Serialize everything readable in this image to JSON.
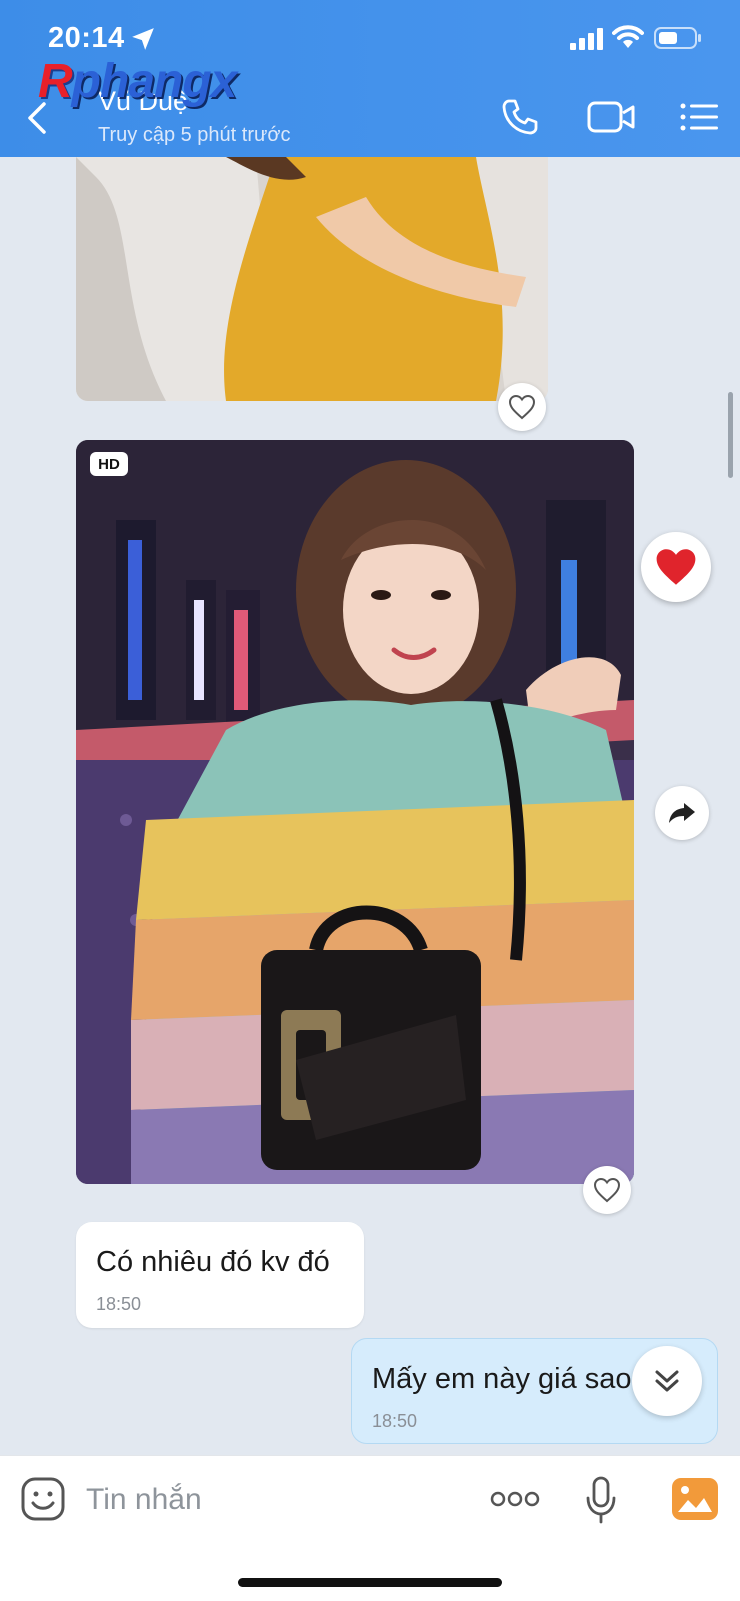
{
  "status_bar": {
    "time": "20:14"
  },
  "watermark": {
    "part1": "R",
    "part2": "phangx"
  },
  "header": {
    "contact_name": "Vũ Duệ",
    "contact_status": "Truy cập 5 phút trước"
  },
  "messages": {
    "photo2_badge": "HD",
    "incoming": {
      "text": "Có nhiêu đó kv đó",
      "time": "18:50"
    },
    "outgoing": {
      "text": "Mấy em này giá sao",
      "time": "18:50"
    }
  },
  "composer": {
    "placeholder": "Tin nhắn"
  },
  "colors": {
    "header": "#4a96ee",
    "outgoing_bubble": "#d6ecfc",
    "background": "#e2e8f0"
  }
}
